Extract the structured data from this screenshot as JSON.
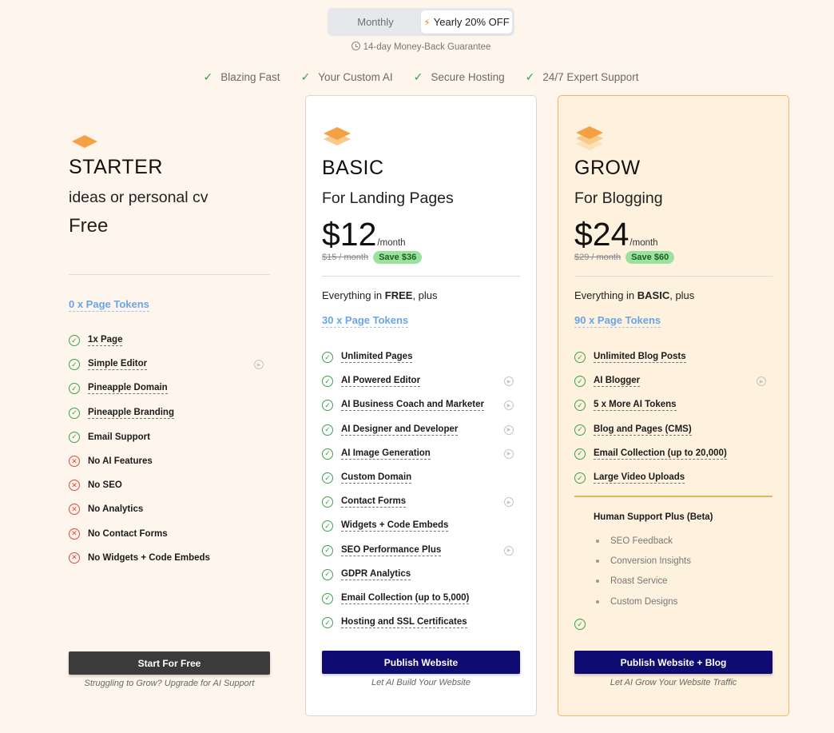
{
  "billing": {
    "monthly_label": "Monthly",
    "yearly_label": "Yearly 20% OFF",
    "selected": "Yearly 20% OFF",
    "guarantee": "14-day Money-Back Guarantee"
  },
  "highlights": [
    "Blazing Fast",
    "Your Custom AI",
    "Secure Hosting",
    "24/7 Expert Support"
  ],
  "colors": {
    "accent": "#f08a24",
    "navy": "#0e0b73",
    "ok": "#3ca24a",
    "no": "#e0473e",
    "link": "#6aa4e8",
    "grow_bg": "#fef1dd"
  },
  "plans": {
    "starter": {
      "name": "STARTER",
      "subtitle": "ideas or personal cv",
      "price": "Free",
      "tokens": "0 x Page Tokens",
      "features": [
        {
          "label": "1x Page",
          "state": "ok",
          "underline": true,
          "video": false
        },
        {
          "label": "Simple Editor",
          "state": "ok",
          "underline": true,
          "video": true
        },
        {
          "label": "Pineapple Domain",
          "state": "ok",
          "underline": true,
          "video": false
        },
        {
          "label": "Pineapple Branding",
          "state": "ok",
          "underline": true,
          "video": false
        },
        {
          "label": "Email Support",
          "state": "ok",
          "underline": false,
          "video": false
        },
        {
          "label": "No AI Features",
          "state": "no",
          "underline": false,
          "video": false
        },
        {
          "label": "No SEO",
          "state": "no",
          "underline": false,
          "video": false
        },
        {
          "label": "No Analytics",
          "state": "no",
          "underline": false,
          "video": false
        },
        {
          "label": "No Contact Forms",
          "state": "no",
          "underline": false,
          "video": false
        },
        {
          "label": "No Widgets + Code Embeds",
          "state": "no",
          "underline": false,
          "video": false
        }
      ],
      "button": "Start For Free",
      "note": "Struggling to Grow? Upgrade for AI Support"
    },
    "basic": {
      "name": "BASIC",
      "subtitle": "For Landing Pages",
      "price": "$12",
      "per": "/month",
      "old_price": "$15 / month",
      "save": "Save $36",
      "everything_pre": "Everything in ",
      "everything_bold": "FREE",
      "everything_post": ", plus",
      "tokens": "30 x Page Tokens",
      "features": [
        {
          "label": "Unlimited Pages",
          "state": "ok",
          "underline": true,
          "video": false
        },
        {
          "label": "AI Powered Editor",
          "state": "ok",
          "underline": true,
          "video": true
        },
        {
          "label": "AI Business Coach and Marketer",
          "state": "ok",
          "underline": true,
          "video": true
        },
        {
          "label": "AI Designer and Developer",
          "state": "ok",
          "underline": true,
          "video": true
        },
        {
          "label": "AI Image Generation",
          "state": "ok",
          "underline": true,
          "video": true
        },
        {
          "label": "Custom Domain",
          "state": "ok",
          "underline": true,
          "video": false
        },
        {
          "label": "Contact Forms",
          "state": "ok",
          "underline": true,
          "video": true
        },
        {
          "label": "Widgets + Code Embeds",
          "state": "ok",
          "underline": true,
          "video": false
        },
        {
          "label": "SEO Performance Plus",
          "state": "ok",
          "underline": true,
          "video": true
        },
        {
          "label": "GDPR Analytics",
          "state": "ok",
          "underline": true,
          "video": false
        },
        {
          "label": "Email Collection (up to 5,000)",
          "state": "ok",
          "underline": true,
          "video": false
        },
        {
          "label": "Hosting and SSL Certificates",
          "state": "ok",
          "underline": true,
          "video": false
        }
      ],
      "button": "Publish Website",
      "note": "Let AI Build Your Website"
    },
    "grow": {
      "name": "GROW",
      "subtitle": "For Blogging",
      "price": "$24",
      "per": "/month",
      "old_price": "$29 / month",
      "save": "Save $60",
      "everything_pre": "Everything in ",
      "everything_bold": "BASIC",
      "everything_post": ", plus",
      "tokens": "90 x Page Tokens",
      "features": [
        {
          "label": "Unlimited Blog Posts",
          "state": "ok",
          "underline": true,
          "video": false
        },
        {
          "label": "AI Blogger",
          "state": "ok",
          "underline": true,
          "video": true
        },
        {
          "label": "5 x More AI Tokens",
          "state": "ok",
          "underline": true,
          "video": false
        },
        {
          "label": "Blog and Pages (CMS)",
          "state": "ok",
          "underline": true,
          "video": false
        },
        {
          "label": "Email Collection (up to 20,000)",
          "state": "ok",
          "underline": true,
          "video": false
        },
        {
          "label": "Large Video Uploads",
          "state": "ok",
          "underline": true,
          "video": false
        }
      ],
      "human_support": {
        "title": "Human Support Plus (Beta)",
        "items": [
          "SEO Feedback",
          "Conversion Insights",
          "Roast Service",
          "Custom Designs"
        ]
      },
      "button": "Publish Website + Blog",
      "note": "Let AI Grow Your Website Traffic"
    }
  }
}
